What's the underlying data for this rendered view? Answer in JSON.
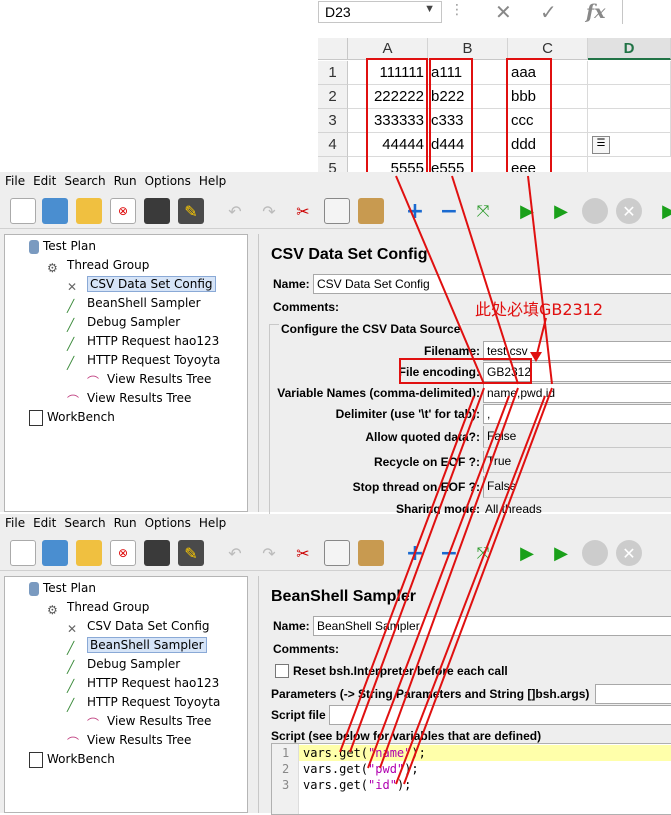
{
  "excel": {
    "name_box": "D23",
    "fx_label": "fx",
    "cancel_glyph": "✕",
    "enter_glyph": "✓",
    "columns": [
      "A",
      "B",
      "C",
      "D"
    ],
    "rows": [
      "1",
      "2",
      "3",
      "4",
      "5"
    ],
    "cells": [
      [
        "111111",
        "a111",
        "aaa"
      ],
      [
        "222222",
        "b222",
        "bbb"
      ],
      [
        "333333",
        "c333",
        "ccc"
      ],
      [
        "44444",
        "d444",
        "ddd"
      ],
      [
        "5555",
        "e555",
        "eee"
      ]
    ]
  },
  "annotation": "此处必填GB2312",
  "menu": [
    "File",
    "Edit",
    "Search",
    "Run",
    "Options",
    "Help"
  ],
  "tree": {
    "items": [
      {
        "label": "Test Plan"
      },
      {
        "label": "Thread Group"
      },
      {
        "label": "CSV Data Set Config"
      },
      {
        "label": "BeanShell Sampler"
      },
      {
        "label": "Debug Sampler"
      },
      {
        "label": "HTTP Request  hao123"
      },
      {
        "label": "HTTP Request  Toyoyta"
      },
      {
        "label": "View Results Tree"
      },
      {
        "label": "View Results Tree"
      },
      {
        "label": "WorkBench"
      }
    ]
  },
  "csv_panel": {
    "title": "CSV Data Set Config",
    "name_label": "Name:",
    "name_value": "CSV Data Set Config",
    "comments_label": "Comments:",
    "section_title": "Configure the CSV Data Source",
    "fields": [
      {
        "label": "Filename:",
        "value": "test.csv"
      },
      {
        "label": "File encoding:",
        "value": "GB2312"
      },
      {
        "label": "Variable Names (comma-delimited):",
        "value": "name,pwd,id"
      },
      {
        "label": "Delimiter (use '\\t' for tab):",
        "value": ","
      },
      {
        "label": "Allow quoted data?:",
        "value": "False"
      },
      {
        "label": "Recycle on EOF ?:",
        "value": "True"
      },
      {
        "label": "Stop thread on EOF ?:",
        "value": "False"
      },
      {
        "label": "Sharing mode:",
        "value": "All threads"
      }
    ]
  },
  "bsh_panel": {
    "title": "BeanShell Sampler",
    "name_label": "Name:",
    "name_value": "BeanShell Sampler",
    "comments_label": "Comments:",
    "reset_label": "Reset bsh.Interpreter before each call",
    "params_label": "Parameters (-> String Parameters and String []bsh.args)",
    "script_file_label": "Script file",
    "script_label": "Script (see below for variables that are defined)",
    "script_lines": [
      {
        "num": "1",
        "pre": "vars.get(",
        "str": "\"name\"",
        "post": ");"
      },
      {
        "num": "2",
        "pre": "vars.get(",
        "str": "\"pwd\"",
        "post": ");"
      },
      {
        "num": "3",
        "pre": "vars.get(",
        "str": "\"id\"",
        "post": ");"
      }
    ]
  },
  "colors": {
    "annotation_red": "#e01010",
    "selection": "#d6e4f7",
    "excel_header_active": "#217346",
    "string_literal": "#b000b0",
    "line_highlight": "#ffffaa"
  }
}
